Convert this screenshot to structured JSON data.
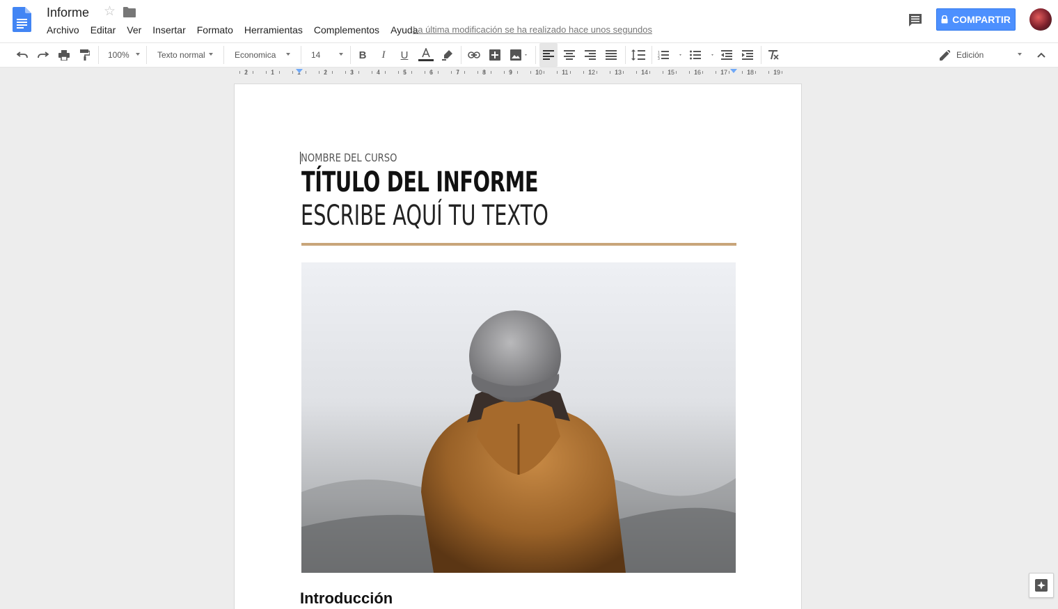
{
  "doc": {
    "title": "Informe",
    "menu": [
      "Archivo",
      "Editar",
      "Ver",
      "Insertar",
      "Formato",
      "Herramientas",
      "Complementos",
      "Ayuda"
    ],
    "last_edit": "La última modificación se ha realizado hace unos segundos"
  },
  "header": {
    "share_label": "COMPARTIR",
    "brand_color": "#4d90fe"
  },
  "toolbar": {
    "zoom": "100%",
    "style": "Texto normal",
    "font": "Economica",
    "size": "14",
    "mode": "Edición"
  },
  "ruler": {
    "ticks": [
      "2",
      "1",
      "1",
      "2",
      "3",
      "4",
      "5",
      "6",
      "7",
      "8",
      "9",
      "10",
      "11",
      "12",
      "13",
      "14",
      "15",
      "16",
      "17",
      "18",
      "19"
    ]
  },
  "page": {
    "course": "NOMBRE DEL CURSO",
    "title": "TÍTULO DEL INFORME",
    "subtitle": "ESCRIBE AQUÍ TU TEXTO",
    "heading": "Introducción",
    "accent_color": "#c8a57a"
  }
}
